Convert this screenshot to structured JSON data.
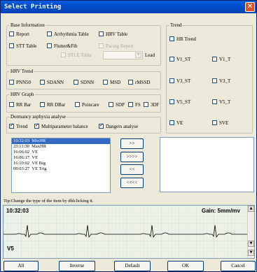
{
  "window": {
    "title": "Select Printing"
  },
  "base_info": {
    "title": "Base Information",
    "items": [
      {
        "label": "Report",
        "checked": false,
        "enabled": true
      },
      {
        "label": "Arrhythmia Table",
        "checked": false,
        "enabled": true
      },
      {
        "label": "HRV Table",
        "checked": false,
        "enabled": true
      },
      {
        "label": "STT Table",
        "checked": false,
        "enabled": true
      },
      {
        "label": "Flutter&Fib",
        "checked": false,
        "enabled": true
      },
      {
        "label": "Pacing Report",
        "checked": false,
        "enabled": false
      },
      {
        "label": "STLE Table",
        "checked": false,
        "enabled": false
      }
    ],
    "lead_label": "Lead",
    "lead_value": ""
  },
  "hrv_trend": {
    "title": "HRV Trend",
    "items": [
      "PNN50",
      "SDANN",
      "SDNN",
      "MSD",
      "rMSSD"
    ]
  },
  "hrv_graph": {
    "title": "HRV Graph",
    "items": [
      "RR Bar",
      "RR DBar",
      "Poincare",
      "SDP",
      "FS",
      "3DF"
    ]
  },
  "dormancy": {
    "title": "Dormancy asphyxia analyse",
    "items": [
      {
        "label": "Trend",
        "checked": true
      },
      {
        "label": "Multiparameter balance",
        "checked": true
      },
      {
        "label": "Dangers analyse",
        "checked": true
      }
    ]
  },
  "trend": {
    "title": "Trend",
    "items": [
      "HR Trend",
      "V1_ST",
      "V1_T",
      "V3_ST",
      "V3_T",
      "V5_ST",
      "V5_T",
      "VE",
      "SVE"
    ]
  },
  "events": [
    {
      "time": "10:32:03",
      "name": "MinHR"
    },
    {
      "time": "23:11:30",
      "name": "MaxHR"
    },
    {
      "time": "16:06:02",
      "name": "VE"
    },
    {
      "time": "16:06:17",
      "name": "VE"
    },
    {
      "time": "16:10:02",
      "name": "VE Big"
    },
    {
      "time": "09:03:27",
      "name": "VE Trig"
    }
  ],
  "move_buttons": [
    ">>",
    ">>>>",
    "<<",
    "<<<<"
  ],
  "tip": "Tip:Change the type of the item by dblclicking it.",
  "ecg": {
    "time": "10:32:03",
    "gain": "Gain: 5mm/mv",
    "lead": "V5",
    "grid_color": "#b8dcd0",
    "trace_color": "#000000"
  },
  "footer": [
    "All",
    "Inverse",
    "Default",
    "OK",
    "Cancel"
  ]
}
